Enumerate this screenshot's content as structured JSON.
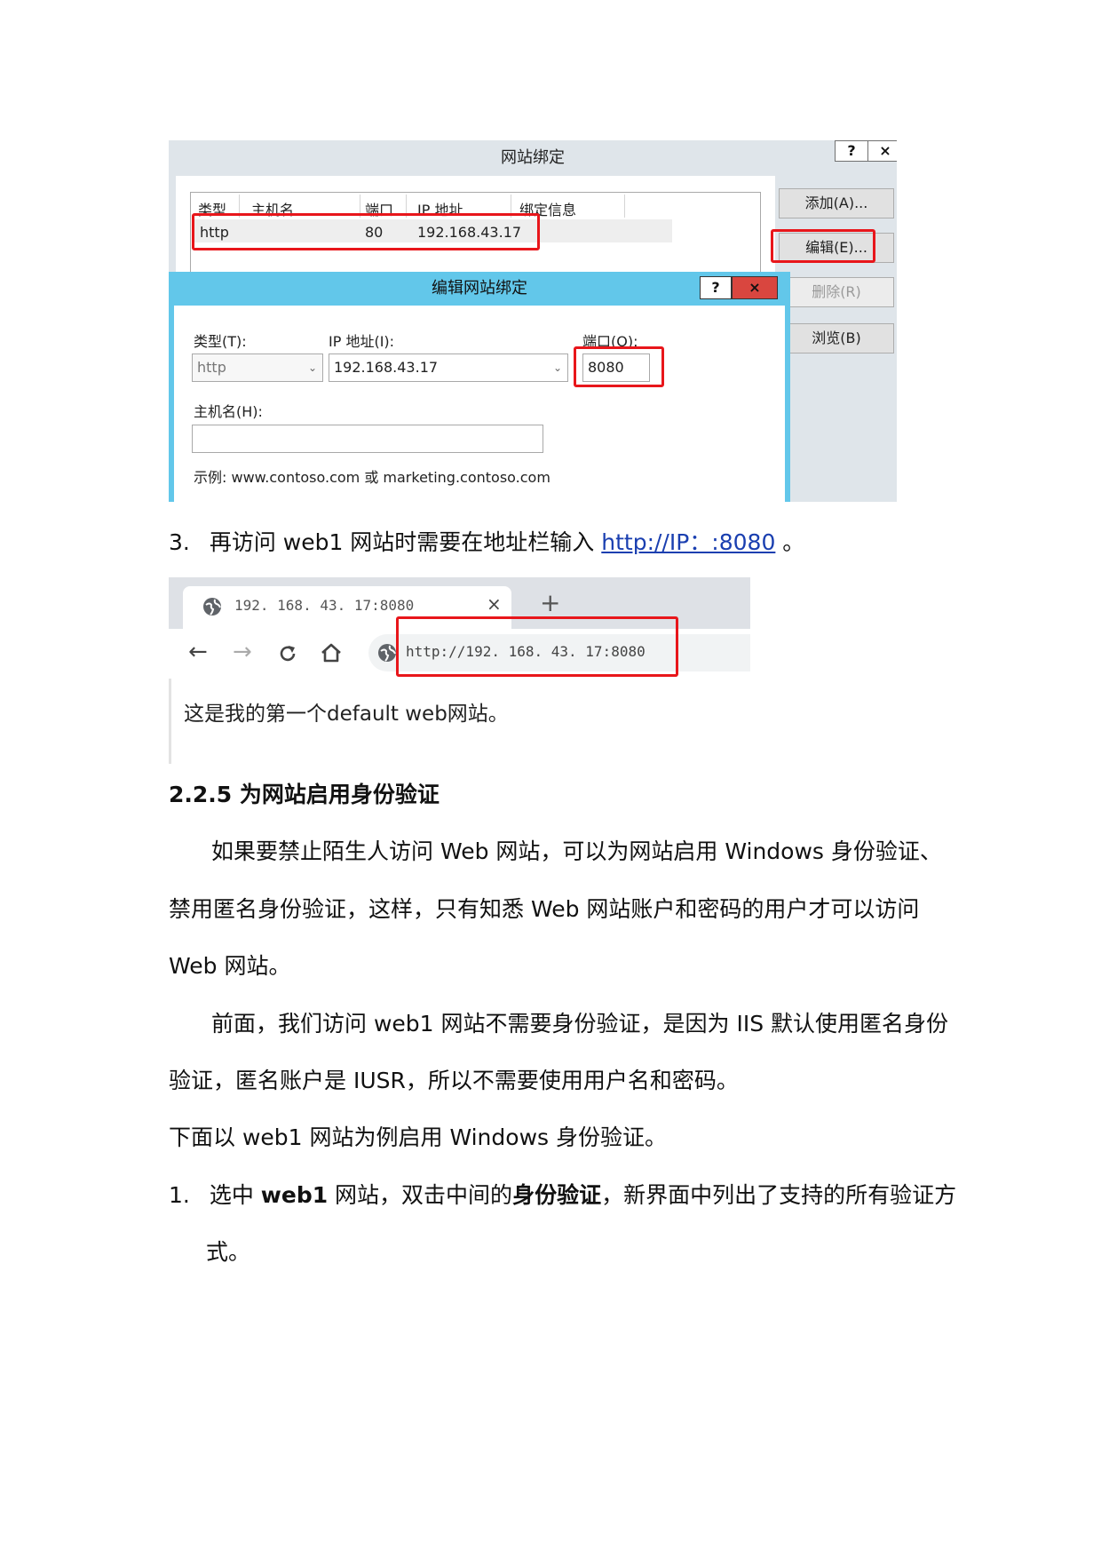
{
  "binding_dialog": {
    "title": "网站绑定",
    "help_btn": "?",
    "close_btn": "×",
    "columns": [
      "类型",
      "主机名",
      "端口",
      "IP 地址",
      "绑定信息"
    ],
    "row": {
      "type": "http",
      "host": "",
      "port": "80",
      "ip": "192.168.43.17",
      "info": ""
    },
    "buttons": {
      "add": "添加(A)...",
      "edit": "编辑(E)...",
      "delete": "删除(R)",
      "browse": "浏览(B)"
    }
  },
  "edit_dialog": {
    "title": "编辑网站绑定",
    "help_btn": "?",
    "close_btn": "×",
    "type_label": "类型(T):",
    "type_value": "http",
    "ip_label": "IP 地址(I):",
    "ip_value": "192.168.43.17",
    "port_label": "端口(O):",
    "port_value": "8080",
    "host_label": "主机名(H):",
    "host_value": "",
    "example": "示例: www.contoso.com 或 marketing.contoso.com"
  },
  "step3": {
    "number": "3.",
    "text_before": "再访问 web1 网站时需要在地址栏输入 ",
    "link": "http://IP：:8080",
    "text_after": " 。"
  },
  "browser": {
    "tab_title": "192. 168. 43. 17:8080",
    "tab_close": "×",
    "new_tab": "+",
    "back": "←",
    "forward": "→",
    "reload": "C",
    "home": "⌂",
    "address": "http://192. 168. 43. 17:8080",
    "page_text": "这是我的第一个default web网站。"
  },
  "section": {
    "heading": "2.2.5 为网站启用身份验证",
    "para1_line1": "如果要禁止陌生人访问 Web 网站，可以为网站启用 Windows 身份验证、",
    "para1_line2": "禁用匿名身份验证，这样，只有知悉 Web 网站账户和密码的用户才可以访问",
    "para1_line3": "Web 网站。",
    "para2_line1": "前面，我们访问 web1 网站不需要身份验证，是因为 IIS 默认使用匿名身份",
    "para2_line2": "验证，匿名账户是 IUSR，所以不需要使用用户名和密码。",
    "para3": "下面以 web1 网站为例启用 Windows 身份验证。",
    "step1_number": "1.",
    "step1_a": "选中 ",
    "step1_b": "web1",
    "step1_c": " 网站，双击中间的",
    "step1_d": "身份验证",
    "step1_e": "，新界面中列出了支持的所有验证方",
    "step1_line2": "式。"
  }
}
